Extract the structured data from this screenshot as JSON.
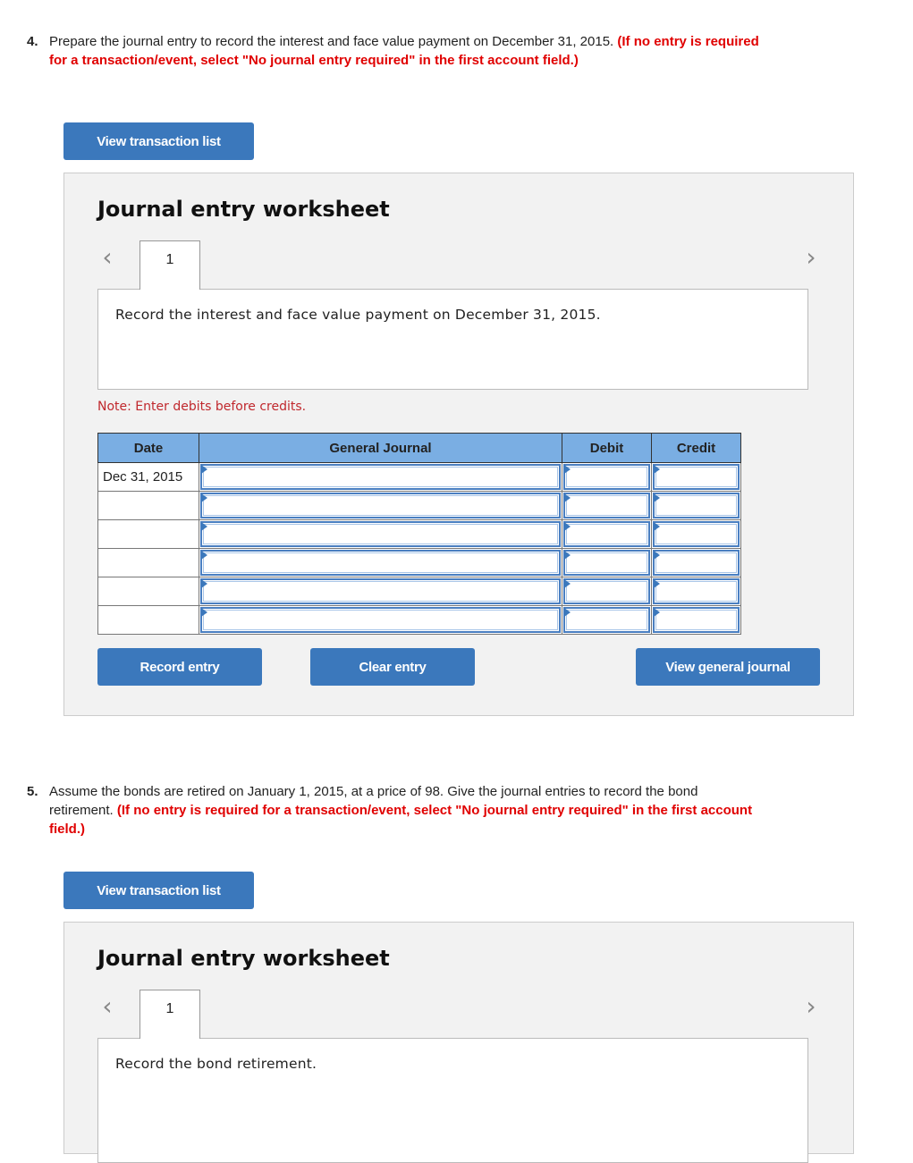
{
  "q4": {
    "number": "4.",
    "text": "Prepare the journal entry to record the interest and face value payment on December 31, 2015.",
    "instruction": "(If no entry is required for a transaction/event, select \"No journal entry required\" in the first account field.)",
    "view_transaction_list": "View transaction list",
    "worksheet": {
      "title": "Journal entry worksheet",
      "prev_icon": "chevron-left-icon",
      "next_icon": "chevron-right-icon",
      "tab_label": "1",
      "description": "Record the interest and face value payment on December 31, 2015.",
      "note": "Note: Enter debits before credits.",
      "table": {
        "headers": [
          "Date",
          "General Journal",
          "Debit",
          "Credit"
        ],
        "rows": [
          {
            "date": "Dec 31, 2015",
            "account": "",
            "debit": "",
            "credit": ""
          },
          {
            "date": "",
            "account": "",
            "debit": "",
            "credit": ""
          },
          {
            "date": "",
            "account": "",
            "debit": "",
            "credit": ""
          },
          {
            "date": "",
            "account": "",
            "debit": "",
            "credit": ""
          },
          {
            "date": "",
            "account": "",
            "debit": "",
            "credit": ""
          },
          {
            "date": "",
            "account": "",
            "debit": "",
            "credit": ""
          }
        ]
      },
      "record_entry": "Record entry",
      "clear_entry": "Clear entry",
      "view_general_journal": "View general journal"
    }
  },
  "q5": {
    "number": "5.",
    "text": "Assume the bonds are retired on January 1, 2015, at a price of 98. Give the journal entries to record the bond retirement.",
    "instruction": "(If no entry is required for a transaction/event, select \"No journal entry required\" in the first account field.)",
    "view_transaction_list": "View transaction list",
    "worksheet": {
      "title": "Journal entry worksheet",
      "prev_icon": "chevron-left-icon",
      "next_icon": "chevron-right-icon",
      "tab_label": "1",
      "description": "Record the bond retirement."
    }
  },
  "colors": {
    "button": "#3b78bc",
    "instruction_red": "#e00000",
    "note_red": "#c0282d",
    "table_header": "#7aaee3",
    "panel_bg": "#f2f2f2"
  }
}
